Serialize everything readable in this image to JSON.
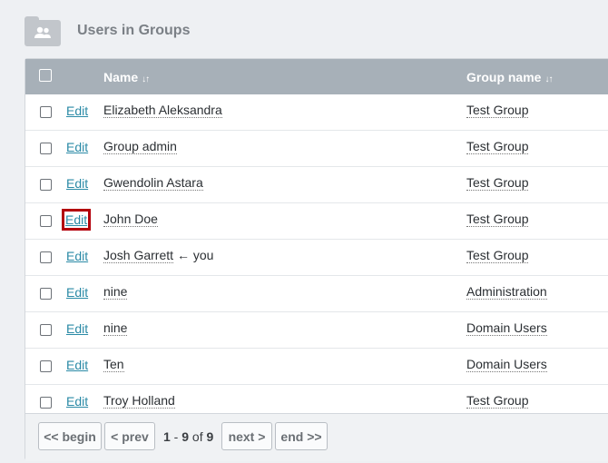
{
  "header": {
    "title": "Users in Groups",
    "icon": "users-folder-icon"
  },
  "table": {
    "columns": {
      "name": "Name",
      "group": "Group name",
      "sort_glyph": "↓↑"
    },
    "edit_label": "Edit",
    "rows": [
      {
        "name": "Elizabeth Aleksandra",
        "group": "Test Group",
        "you": ""
      },
      {
        "name": "Group admin",
        "group": "Test Group",
        "you": ""
      },
      {
        "name": "Gwendolin Astara",
        "group": "Test Group",
        "you": ""
      },
      {
        "name": "John Doe",
        "group": "Test Group",
        "you": ""
      },
      {
        "name": "Josh Garrett",
        "group": "Test Group",
        "you": "← you"
      },
      {
        "name": "nine",
        "group": "Administration",
        "you": ""
      },
      {
        "name": "nine",
        "group": "Domain Users",
        "you": ""
      },
      {
        "name": "Ten",
        "group": "Domain Users",
        "you": ""
      },
      {
        "name": "Troy Holland",
        "group": "Test Group",
        "you": ""
      }
    ]
  },
  "pager": {
    "begin": "<< begin",
    "prev": "< prev",
    "range_start": "1",
    "range_sep": " - ",
    "range_end": "9",
    "of": " of ",
    "total": "9",
    "next": "next >",
    "end": "end >>"
  },
  "colors": {
    "header_bg": "#a7b0b8",
    "link": "#2a8aa6",
    "highlight": "#b3000c"
  }
}
